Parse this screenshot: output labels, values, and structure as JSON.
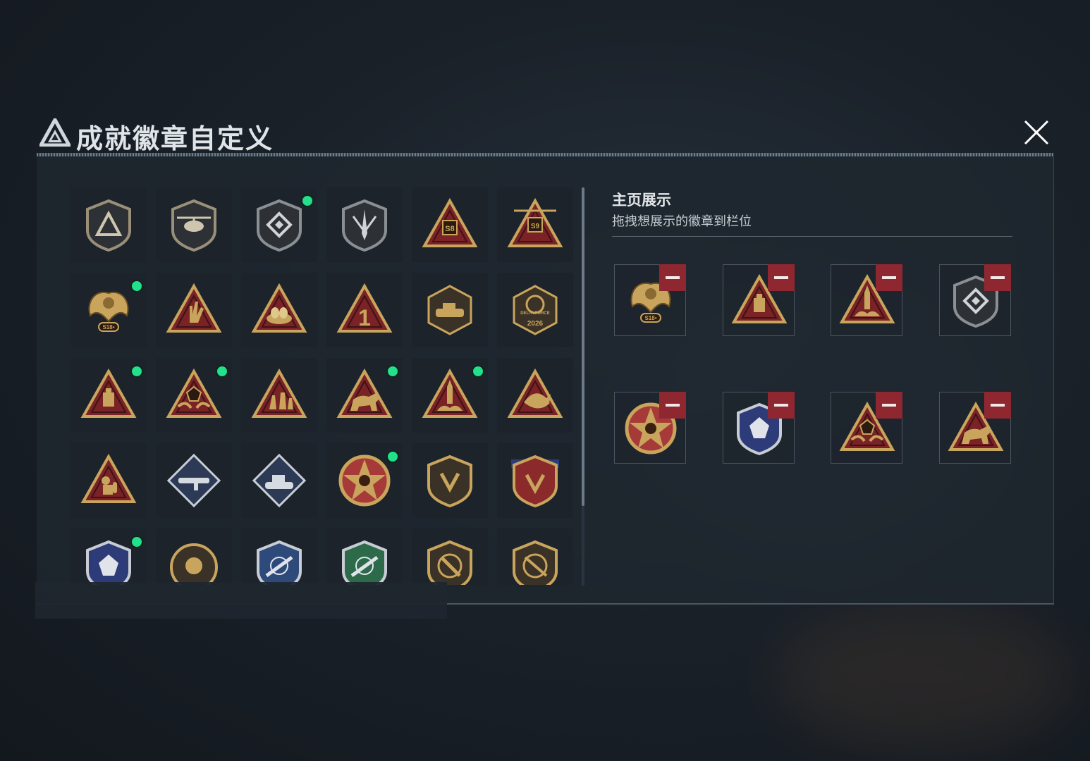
{
  "header": {
    "title": "成就徽章自定义",
    "logo_icon": "delta-logo-icon",
    "close_icon": "close-icon"
  },
  "showcase": {
    "title": "主页展示",
    "hint": "拖拽想展示的徽章到栏位",
    "slots": [
      {
        "badge": "phoenix-s18-badge-icon",
        "remove_icon": "minus-icon"
      },
      {
        "badge": "block-triangle-badge-icon",
        "remove_icon": "minus-icon"
      },
      {
        "badge": "rocket-launch-badge-icon",
        "remove_icon": "minus-icon"
      },
      {
        "badge": "shield-diamond-badge-icon",
        "remove_icon": "minus-icon"
      },
      {
        "badge": "star-skull-medal-icon",
        "remove_icon": "minus-icon"
      },
      {
        "badge": "blue-crest-badge-icon",
        "remove_icon": "minus-icon"
      },
      {
        "badge": "dice-hands-badge-icon",
        "remove_icon": "minus-icon"
      },
      {
        "badge": "bull-triangle-badge-icon",
        "remove_icon": "minus-icon"
      }
    ]
  },
  "badge_texts": {
    "s8": "S8",
    "s9": "S9",
    "s18": "S18•",
    "one": "1",
    "delta_2026": "2026",
    "delta_force": "DELTA FORCE"
  },
  "grid": {
    "rows": [
      [
        {
          "icon": "delta-shield-badge-icon",
          "new": false
        },
        {
          "icon": "helicopter-badge-icon",
          "new": false
        },
        {
          "icon": "shield-diamond-badge-icon",
          "new": true
        },
        {
          "icon": "dagger-shield-badge-icon",
          "new": false
        },
        {
          "icon": "s8-triangle-badge-icon",
          "new": false
        },
        {
          "icon": "s9-triangle-badge-icon",
          "new": false
        }
      ],
      [
        {
          "icon": "phoenix-s18-badge-icon",
          "new": true
        },
        {
          "icon": "hand-sign-badge-icon",
          "new": false
        },
        {
          "icon": "nest-egg-badge-icon",
          "new": false
        },
        {
          "icon": "number-one-badge-icon",
          "new": false
        },
        {
          "icon": "delta-force-tank-badge-icon",
          "new": false
        },
        {
          "icon": "delta-force-2026-badge-icon",
          "new": false
        }
      ],
      [
        {
          "icon": "block-triangle-badge-icon",
          "new": true
        },
        {
          "icon": "dice-hands-badge-icon",
          "new": true
        },
        {
          "icon": "soldiers-triangle-badge-icon",
          "new": false
        },
        {
          "icon": "bull-triangle-badge-icon",
          "new": true
        },
        {
          "icon": "rocket-launch-badge-icon",
          "new": true
        },
        {
          "icon": "fish-triangle-badge-icon",
          "new": false
        }
      ],
      [
        {
          "icon": "diver-triangle-badge-icon",
          "new": false
        },
        {
          "icon": "launcher-diamond-badge-icon",
          "new": false
        },
        {
          "icon": "tank-diamond-badge-icon",
          "new": false
        },
        {
          "icon": "star-skull-medal-icon",
          "new": true
        },
        {
          "icon": "bronze-shield-badge-icon",
          "new": false
        },
        {
          "icon": "ribbon-shield-badge-icon",
          "new": false
        }
      ],
      [
        {
          "icon": "blue-crest-badge-icon",
          "new": true
        },
        {
          "icon": "skull-round-badge-icon",
          "new": false
        },
        {
          "icon": "blue-rifle-crest-icon",
          "new": false
        },
        {
          "icon": "green-rifle-crest-icon",
          "new": false
        },
        {
          "icon": "pistol-shield-badge-icon",
          "new": false
        },
        {
          "icon": "rifle-shield-badge-icon",
          "new": false
        }
      ]
    ]
  },
  "colors": {
    "new_indicator": "#22e08c",
    "remove_button": "#8f2730",
    "badge_gold": "#c9a45c",
    "badge_red": "#7a2226"
  }
}
